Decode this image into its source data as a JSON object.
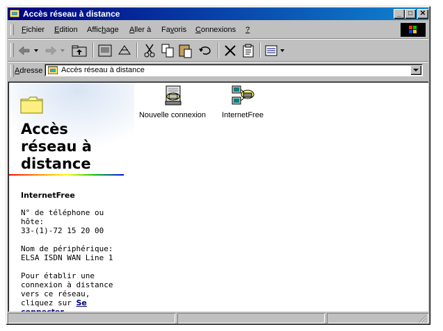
{
  "window": {
    "title": "Accès réseau à distance"
  },
  "menu": [
    {
      "label_pre": "",
      "accel": "F",
      "label_post": "ichier"
    },
    {
      "label_pre": "",
      "accel": "E",
      "label_post": "dition"
    },
    {
      "label_pre": "Affic",
      "accel": "h",
      "label_post": "age"
    },
    {
      "label_pre": "",
      "accel": "A",
      "label_post": "ller à"
    },
    {
      "label_pre": "Fa",
      "accel": "v",
      "label_post": "oris"
    },
    {
      "label_pre": "",
      "accel": "C",
      "label_post": "onnexions"
    },
    {
      "label_pre": "",
      "accel": "?",
      "label_post": ""
    }
  ],
  "address": {
    "label_pre": "A",
    "label_post": "dresse",
    "value": "Accès réseau à distance"
  },
  "panel": {
    "title": "Accès réseau à distance",
    "selected_name": "InternetFree",
    "phone_label": "N° de téléphone ou hôte:",
    "phone_value": "33-(1)-72 15 20 00",
    "device_label": "Nom de périphérique:",
    "device_value": "ELSA ISDN WAN Line 1",
    "help_text": "Pour établir une connexion à distance vers ce réseau, cliquez sur ",
    "help_link": "Se connecter",
    "help_end": "."
  },
  "items": [
    {
      "label": "Nouvelle connexion",
      "icon": "new-connection-icon"
    },
    {
      "label": "InternetFree",
      "icon": "dialup-connection-icon"
    }
  ],
  "colors": {
    "titlebar_start": "#000080",
    "titlebar_end": "#1084d0",
    "link": "#000080"
  }
}
